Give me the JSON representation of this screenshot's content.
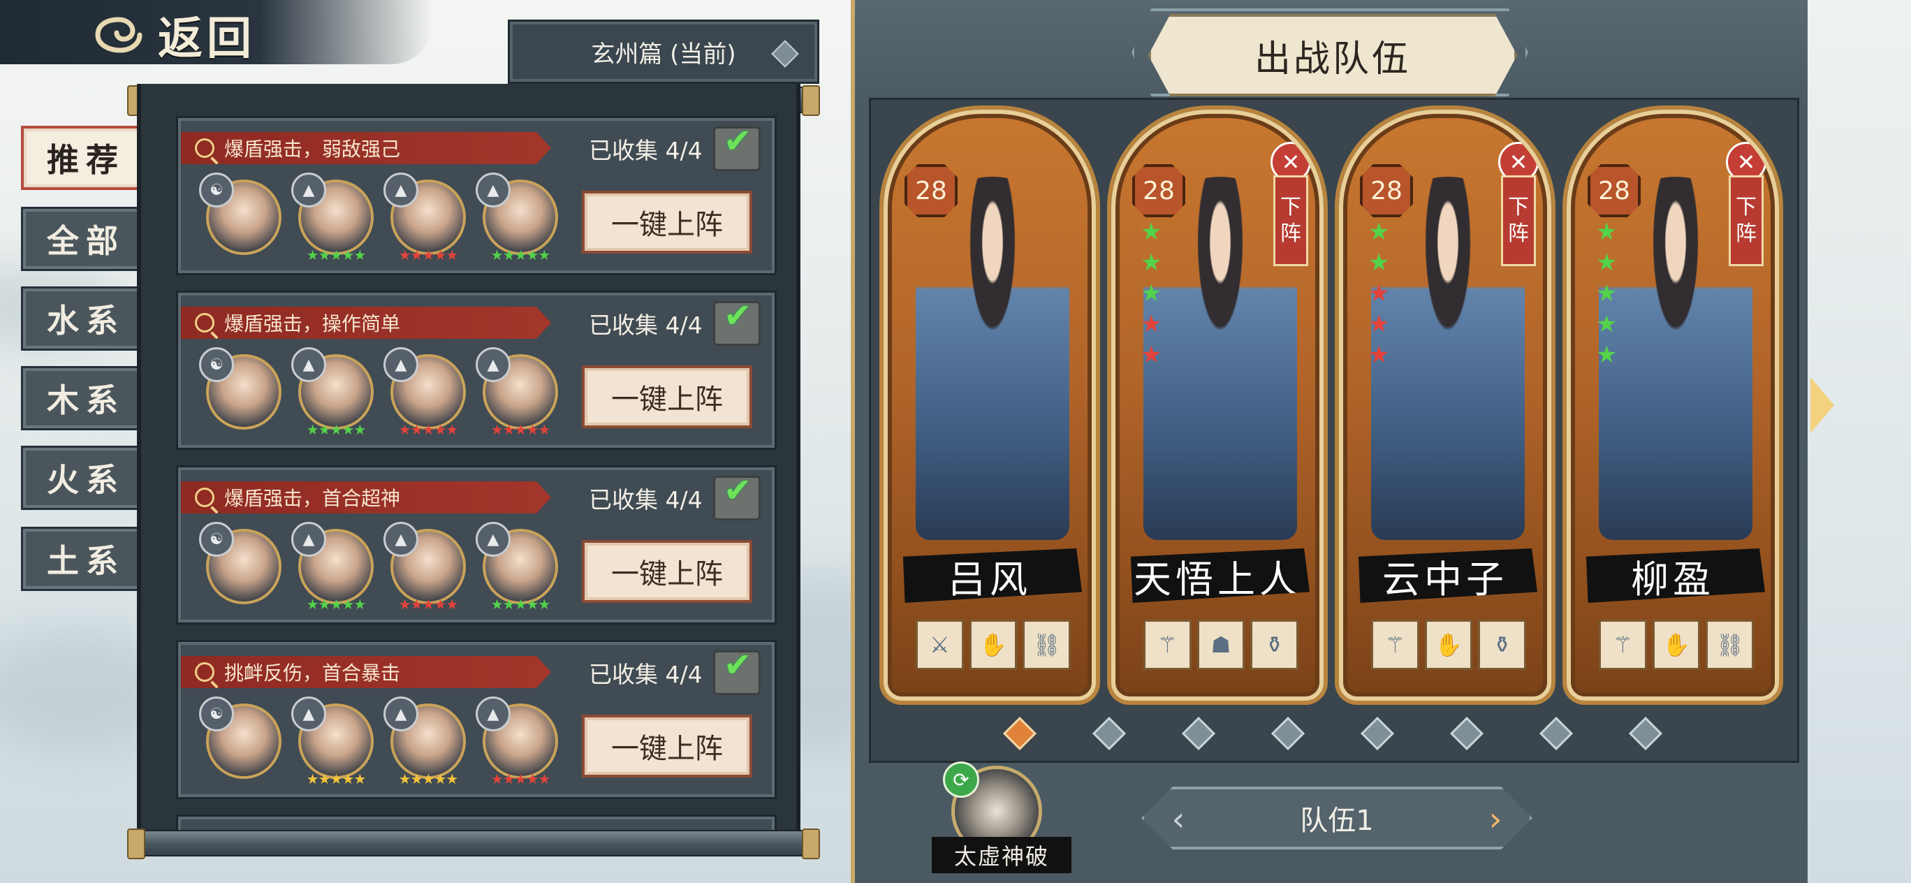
{
  "back_button": {
    "label": "返回"
  },
  "chapter_select": {
    "value": "玄州篇 (当前)"
  },
  "tabs": [
    {
      "label": "推荐",
      "active": true
    },
    {
      "label": "全部",
      "active": false
    },
    {
      "label": "水系",
      "active": false
    },
    {
      "label": "木系",
      "active": false
    },
    {
      "label": "火系",
      "active": false
    },
    {
      "label": "土系",
      "active": false
    }
  ],
  "teams": [
    {
      "tag": "爆盾强击，弱敌强己",
      "collected": "已收集 4/4",
      "deploy_label": "一键上阵",
      "members": [
        {
          "element_badge": "☯",
          "stars": ""
        },
        {
          "element_badge": "▲",
          "stars": "★★★★★"
        },
        {
          "element_badge": "▲",
          "stars": "★★★★★"
        },
        {
          "element_badge": "▲",
          "stars": "★★★★★"
        }
      ]
    },
    {
      "tag": "爆盾强击，操作简单",
      "collected": "已收集 4/4",
      "deploy_label": "一键上阵",
      "members": [
        {
          "element_badge": "☯",
          "stars": ""
        },
        {
          "element_badge": "▲",
          "stars": "★★★★★"
        },
        {
          "element_badge": "▲",
          "stars": "★★★★★"
        },
        {
          "element_badge": "▲",
          "stars": "★★★★★"
        }
      ]
    },
    {
      "tag": "爆盾强击，首合超神",
      "collected": "已收集 4/4",
      "deploy_label": "一键上阵",
      "members": [
        {
          "element_badge": "☯",
          "stars": ""
        },
        {
          "element_badge": "▲",
          "stars": "★★★★★"
        },
        {
          "element_badge": "▲",
          "stars": "★★★★★"
        },
        {
          "element_badge": "▲",
          "stars": "★★★★★"
        }
      ]
    },
    {
      "tag": "挑衅反伤，首合暴击",
      "collected": "已收集 4/4",
      "deploy_label": "一键上阵",
      "members": [
        {
          "element_badge": "☯",
          "stars": ""
        },
        {
          "element_badge": "▲",
          "stars": "★★★★★"
        },
        {
          "element_badge": "▲",
          "stars": "★★★★★"
        },
        {
          "element_badge": "▲",
          "stars": "★★★★★"
        }
      ]
    }
  ],
  "battle_team": {
    "title": "出战队伍",
    "heroes": [
      {
        "level": "28",
        "name": "吕风",
        "stars": [],
        "removable": false,
        "unequip_label": "",
        "gear": [
          "⚔",
          "✋",
          "⛓"
        ]
      },
      {
        "level": "28",
        "name": "天悟上人",
        "stars": [
          "★",
          "★",
          "★",
          "★",
          "★"
        ],
        "removable": true,
        "unequip_label": "下阵",
        "gear": [
          "⚚",
          "☗",
          "⚱"
        ]
      },
      {
        "level": "28",
        "name": "云中子",
        "stars": [
          "★",
          "★",
          "★",
          "★",
          "★"
        ],
        "removable": true,
        "unequip_label": "下阵",
        "gear": [
          "⚚",
          "✋",
          "⚱"
        ]
      },
      {
        "level": "28",
        "name": "柳盈",
        "stars": [
          "★",
          "★",
          "★",
          "★",
          "★"
        ],
        "removable": true,
        "unequip_label": "下阵",
        "gear": [
          "⚚",
          "✋",
          "⛓"
        ]
      }
    ],
    "team_switch_label": "队伍1",
    "skill_label": "太虚神破"
  },
  "colors": {
    "ribbon_red": "#a3362b",
    "star_green": "#53d24a",
    "star_red": "#e2433a",
    "accent_gold": "#c9a869",
    "dot_active": "#e0823a"
  }
}
